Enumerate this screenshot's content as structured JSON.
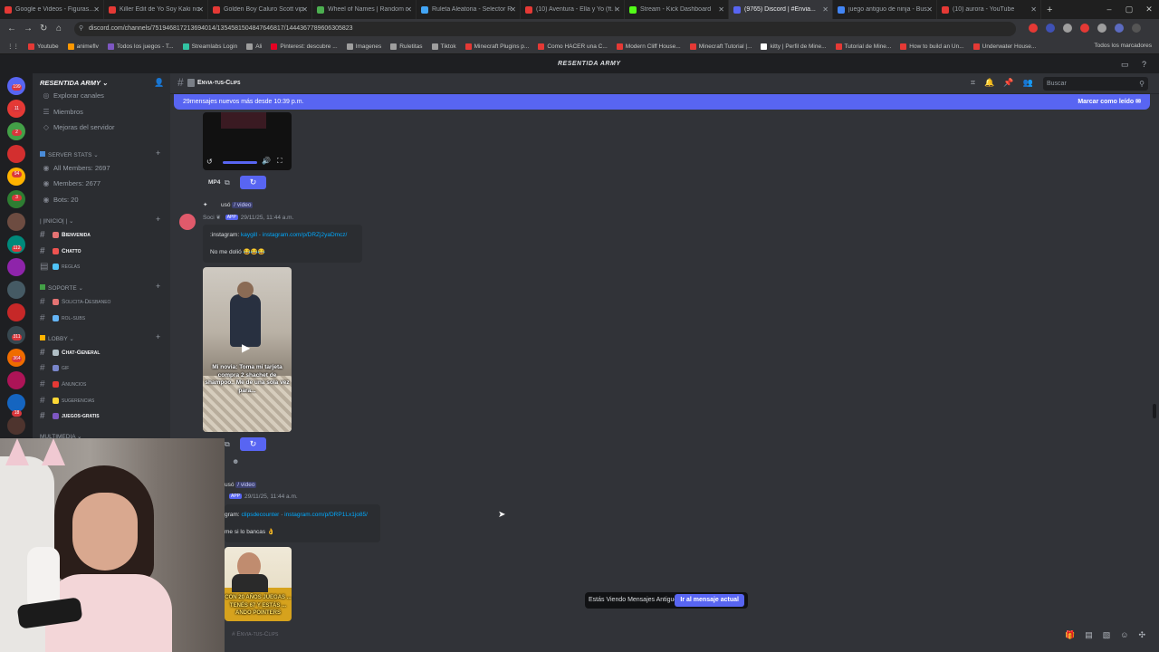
{
  "browser": {
    "tabs": [
      {
        "label": "Google e Videos - Figuras...",
        "color": "#e53935"
      },
      {
        "label": "Killer Edit de Yo Soy Kaki no...",
        "color": "#e53935"
      },
      {
        "label": "Golden Boy Caluro Scott vip...",
        "color": "#e53935"
      },
      {
        "label": "Wheel of Names | Random n...",
        "color": "#4caf50"
      },
      {
        "label": "Ruleta Aleatoria - Selector R...",
        "color": "#42a5f5"
      },
      {
        "label": "(10) Aventura - Ella y Yo (ft. D...",
        "color": "#e53935"
      },
      {
        "label": "Stream - Kick Dashboard",
        "color": "#53fc18"
      },
      {
        "label": "(9765) Discord | #Envia...",
        "color": "#5865f2"
      },
      {
        "label": "juego antiguo de ninja - Bus...",
        "color": "#4285f4"
      },
      {
        "label": "(10) aurora - YouTube",
        "color": "#e53935"
      }
    ],
    "url": "discord.com/channels/751946817213694014/1354581504847646817/1444367789606305823",
    "bookmarks": [
      {
        "label": "Youtube",
        "color": "#e53935"
      },
      {
        "label": "animeflv",
        "color": "#ff9800"
      },
      {
        "label": "Todos los juegos - T...",
        "color": "#7e57c2"
      },
      {
        "label": "Streamlabs Login",
        "color": "#31c3a2"
      },
      {
        "label": "Ali",
        "color": "#9e9e9e"
      },
      {
        "label": "Pinterest: descubre ...",
        "color": "#e60023"
      },
      {
        "label": "Imagenes",
        "color": "#9e9e9e"
      },
      {
        "label": "Ruletitas",
        "color": "#9e9e9e"
      },
      {
        "label": "Tiktok",
        "color": "#9e9e9e"
      },
      {
        "label": "Minecraft Plugins p...",
        "color": "#e53935"
      },
      {
        "label": "Como HACER una C...",
        "color": "#e53935"
      },
      {
        "label": "Modern Cliff House...",
        "color": "#e53935"
      },
      {
        "label": "Minecraft Tutorial |...",
        "color": "#e53935"
      },
      {
        "label": "kitty | Perfil de Mine...",
        "color": "#ffffff"
      },
      {
        "label": "Tutorial de Mine...",
        "color": "#e53935"
      },
      {
        "label": "How to build an Un...",
        "color": "#e53935"
      },
      {
        "label": "Underwater House...",
        "color": "#e53935"
      }
    ],
    "bookmarks_right": "Todos los marcadores"
  },
  "discord": {
    "top_title": "RESENTIDA ARMY",
    "server_name": "RESENTIDA ARMY",
    "guild_badges": [
      "199",
      "11",
      "2",
      "94",
      "3",
      "112",
      "311",
      "364",
      "18"
    ],
    "sidebar": {
      "top_items": [
        {
          "label": "Explorar canales",
          "icon": "compass-icon"
        },
        {
          "label": "Miembros",
          "icon": "members-icon"
        },
        {
          "label": "Mejoras del servidor",
          "icon": "boost-icon"
        }
      ],
      "stats_category": "SERVER STATS",
      "stats": [
        "All Members: 2697",
        "Members: 2677",
        "Bots: 20"
      ],
      "inicio_category": "| |INICIO| |",
      "inicio_channels": [
        {
          "label": "Bienvenida",
          "bold": true
        },
        {
          "label": "Chatto",
          "bold": true
        },
        {
          "label": "reglas",
          "bold": false
        }
      ],
      "soporte_category": "SOPORTE",
      "soporte_channels": [
        "Solicita-Desbaneo",
        "rol-subs"
      ],
      "lobby_category": "LOBBY",
      "lobby_channels": [
        {
          "label": "Chat-General",
          "bold": true
        },
        {
          "label": "gif",
          "bold": false
        },
        {
          "label": "Anuncios",
          "bold": false
        },
        {
          "label": "sugerencias",
          "bold": false
        },
        {
          "label": "juegos-gratis",
          "bold": true
        }
      ],
      "multimedia_category": "MULTIMEDIA"
    },
    "channel_name": "Envia-tus-Clips",
    "search_placeholder": "Buscar",
    "new_messages_text": "29mensajes nuevos más desde 10:39 p.m.",
    "mark_read": "Marcar como leído",
    "messages": [
      {
        "format_label": "MP4",
        "user_suffix": "usó",
        "command": "video",
        "app_tag": "APP",
        "timestamp": "29/11/25, 11:44 a.m.",
        "embed_prefix": ":instagram:",
        "embed_user": "kaygill",
        "embed_link": "instagram.com/p/DRZj2yaDmcz/",
        "text": "No me dolió 😂😂😂",
        "caption": "Mi novia: Toma mi tarjeta compra 2 shachet de shampoo.. Me de una sola vez para..."
      },
      {
        "user_suffix": "usó",
        "command": "video",
        "app_tag": "APP",
        "timestamp": "29/11/25, 11:44 a.m.",
        "embed_prefix": "gram:",
        "embed_user": "clipsdecounter",
        "embed_link": "instagram.com/p/DRP1Lx1jo85/",
        "text": "me si lo bancas 👌",
        "caption": "CON 20 AÑOS JUEGAS ... TENÉS 67 Y ESTÁS ... ANDO POINTERS"
      }
    ],
    "old_messages_text": "Estás Viendo Mensajes Antiguos",
    "go_to_current": "Ir al mensaje actual",
    "footer_channel": "Envia-tus-Clips"
  }
}
